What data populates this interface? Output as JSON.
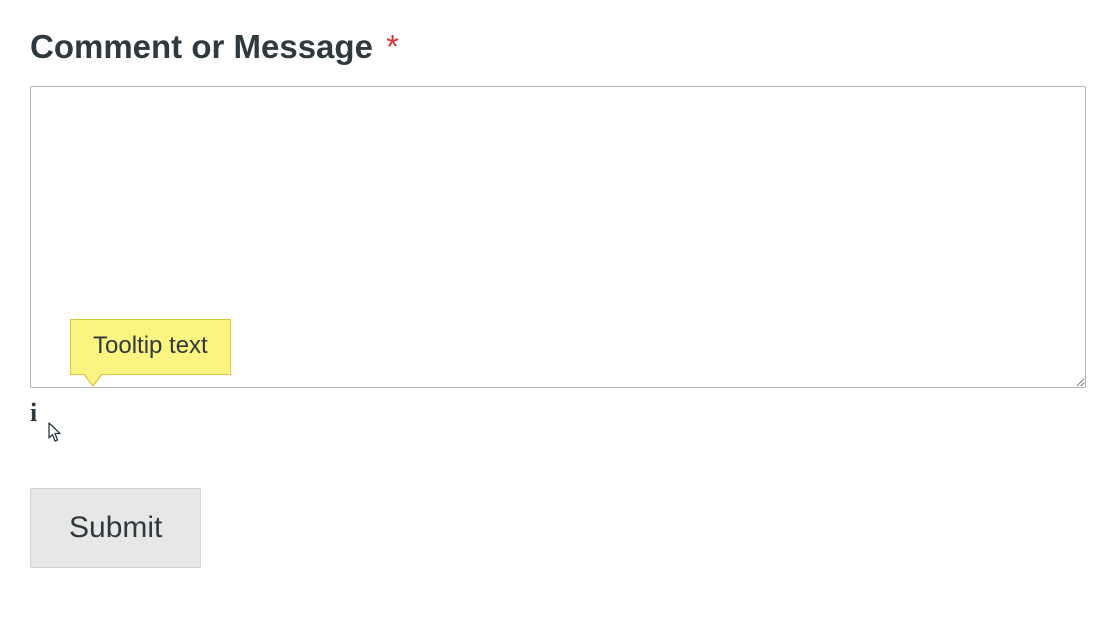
{
  "form": {
    "comment": {
      "label": "Comment or Message",
      "required_marker": "*",
      "value": "",
      "tooltip_text": "Tooltip text"
    },
    "submit_label": "Submit"
  }
}
